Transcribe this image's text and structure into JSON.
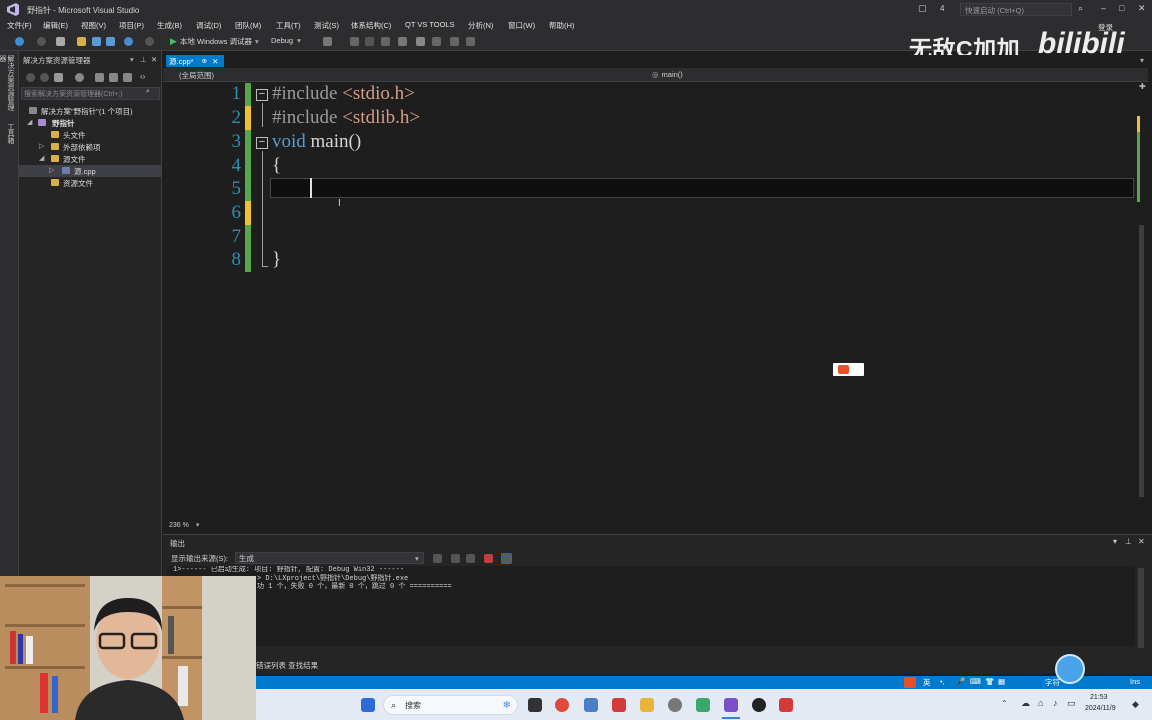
{
  "window": {
    "title": "野指针 - Microsoft Visual Studio",
    "quick_launch_placeholder": "快速启动 (Ctrl+Q)",
    "notification_count": "4",
    "login": "登录"
  },
  "menu": [
    "文件(F)",
    "编辑(E)",
    "视图(V)",
    "项目(P)",
    "生成(B)",
    "调试(D)",
    "团队(M)",
    "工具(T)",
    "测试(S)",
    "体系结构(C)",
    "QT VS TOOLS",
    "分析(N)",
    "窗口(W)",
    "帮助(H)"
  ],
  "toolbar": {
    "run_label": "本地 Windows 调试器",
    "config": "Debug"
  },
  "left_strip": {
    "item1": "解决方案资源管理器",
    "item2": "工具箱"
  },
  "solution_explorer": {
    "title": "解决方案资源管理器",
    "search_placeholder": "搜索解决方案资源管理器(Ctrl+;)",
    "tree": [
      {
        "label": "解决方案\"野指针\"(1 个项目)"
      },
      {
        "label": "野指针"
      },
      {
        "label": "头文件"
      },
      {
        "label": "外部依赖项"
      },
      {
        "label": "源文件"
      },
      {
        "label": "源.cpp"
      },
      {
        "label": "资源文件"
      }
    ]
  },
  "editor": {
    "tab_label": "源.cpp*",
    "scope": "(全局范围)",
    "function": "main()",
    "zoom": "236 %",
    "lines": [
      {
        "num": "1",
        "pp": "#include ",
        "rest": "<stdio.h>"
      },
      {
        "num": "2",
        "pp": "#include ",
        "rest": "<stdlib.h>"
      },
      {
        "num": "3",
        "kw": "void",
        "rest": " main()"
      },
      {
        "num": "4",
        "rest": "{"
      },
      {
        "num": "5",
        "rest": ""
      },
      {
        "num": "6",
        "rest": ""
      },
      {
        "num": "7",
        "rest": ""
      },
      {
        "num": "8",
        "rest": "}"
      }
    ]
  },
  "output": {
    "title": "输出",
    "source_label": "显示输出来源(S):",
    "source_value": "生成",
    "lines": [
      "1>------ 已启动生成: 项目: 野指针, 配置: Debug Win32 ------",
      "",
      "> D:\\LXproject\\野指针\\Debug\\野指针.exe",
      "功 1 个，失败 0 个，最新 0 个，跳过 0 个 =========="
    ],
    "bottom_tab": "错误列表  查找结果"
  },
  "status": {
    "right_char": "字符",
    "ins": "Ins"
  },
  "taskbar": {
    "search_placeholder": "搜索",
    "time": "21:53",
    "date": "2024/11/9",
    "ime": "英"
  },
  "watermark": {
    "text": "无敌C加加",
    "logo": "bilibili"
  }
}
